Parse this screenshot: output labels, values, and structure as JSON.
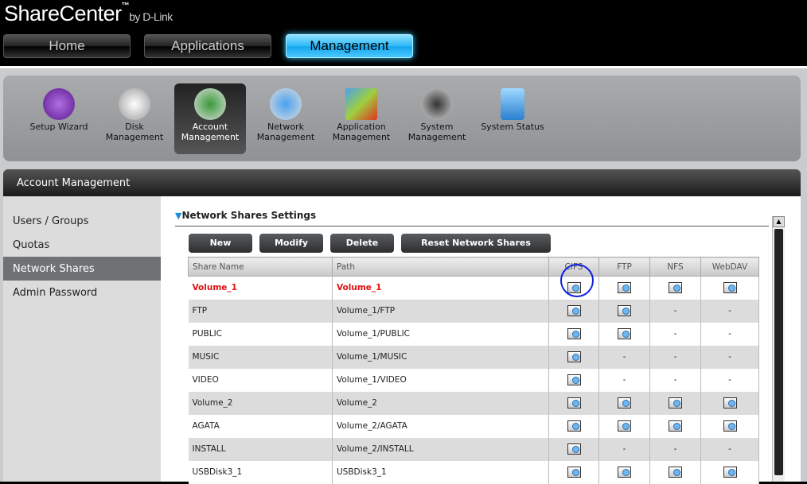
{
  "header": {
    "logo": "ShareCenter",
    "logo_tm": "™",
    "logo_by": "by D-Link",
    "nav": [
      "Home",
      "Applications",
      "Management"
    ],
    "active_nav": "Management"
  },
  "toolbar": {
    "items": [
      "Setup Wizard",
      "Disk Management",
      "Account Management",
      "Network Management",
      "Application Management",
      "System Management",
      "System Status"
    ],
    "active": "Account Management"
  },
  "panel": {
    "title": "Account Management"
  },
  "sidebar": {
    "items": [
      "Users / Groups",
      "Quotas",
      "Network Shares",
      "Admin Password"
    ],
    "active": "Network Shares"
  },
  "section": {
    "title": "Network Shares Settings"
  },
  "buttons": {
    "new": "New",
    "modify": "Modify",
    "delete": "Delete",
    "reset": "Reset Network Shares"
  },
  "table": {
    "headers": [
      "Share Name",
      "Path",
      "CIFS",
      "FTP",
      "NFS",
      "WebDAV"
    ],
    "rows": [
      {
        "name": "Volume_1",
        "path": "Volume_1",
        "cifs": true,
        "ftp": true,
        "nfs": true,
        "webdav": true,
        "highlight": true
      },
      {
        "name": "FTP",
        "path": "Volume_1/FTP",
        "cifs": true,
        "ftp": true,
        "nfs": false,
        "webdav": false
      },
      {
        "name": "PUBLIC",
        "path": "Volume_1/PUBLIC",
        "cifs": true,
        "ftp": true,
        "nfs": false,
        "webdav": false
      },
      {
        "name": "MUSIC",
        "path": "Volume_1/MUSIC",
        "cifs": true,
        "ftp": false,
        "nfs": false,
        "webdav": false
      },
      {
        "name": "VIDEO",
        "path": "Volume_1/VIDEO",
        "cifs": true,
        "ftp": false,
        "nfs": false,
        "webdav": false
      },
      {
        "name": "Volume_2",
        "path": "Volume_2",
        "cifs": true,
        "ftp": true,
        "nfs": true,
        "webdav": true
      },
      {
        "name": "AGATA",
        "path": "Volume_2/AGATA",
        "cifs": true,
        "ftp": true,
        "nfs": true,
        "webdav": true
      },
      {
        "name": "INSTALL",
        "path": "Volume_2/INSTALL",
        "cifs": true,
        "ftp": false,
        "nfs": false,
        "webdav": false
      },
      {
        "name": "USBDisk3_1",
        "path": "USBDisk3_1",
        "cifs": true,
        "ftp": true,
        "nfs": true,
        "webdav": true
      }
    ],
    "disabled_mark": "-"
  }
}
